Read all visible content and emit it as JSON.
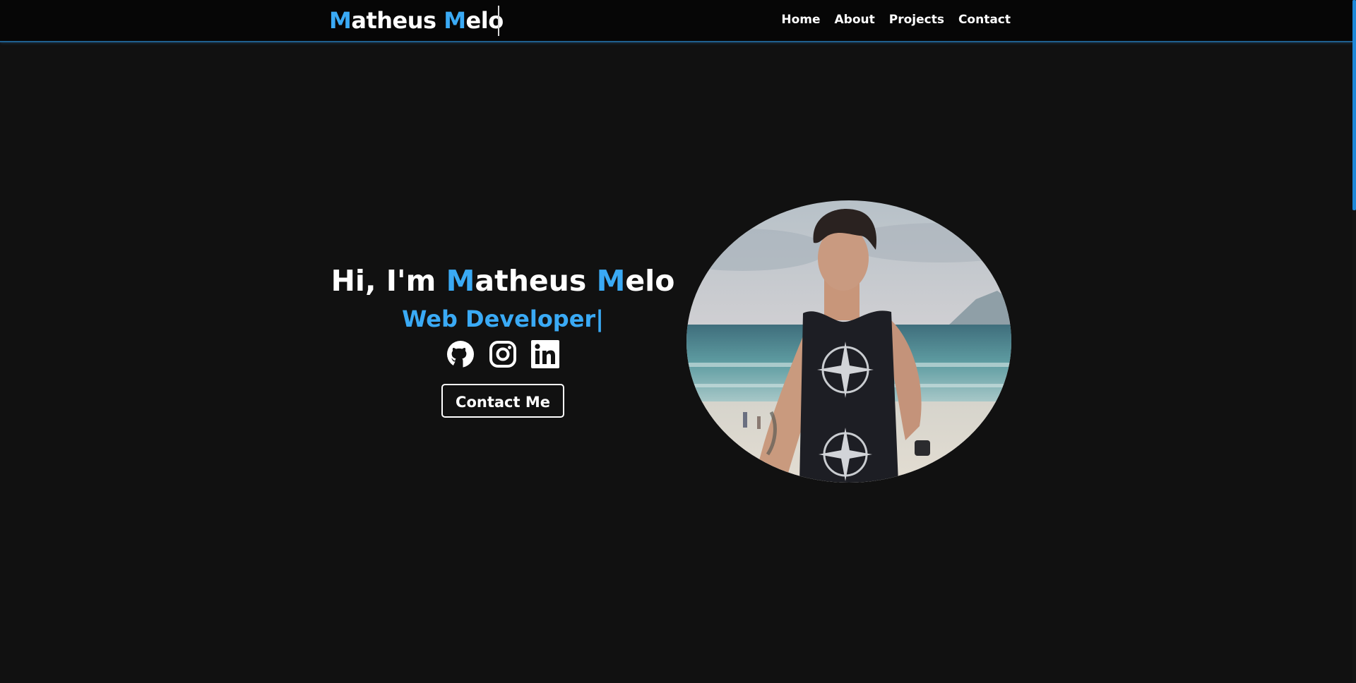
{
  "nav": {
    "logo": {
      "first_initial": "M",
      "first_rest": "atheus ",
      "last_initial": "M",
      "last_rest": "elo"
    },
    "links": [
      {
        "label": "Home"
      },
      {
        "label": "About"
      },
      {
        "label": "Projects"
      },
      {
        "label": "Contact"
      }
    ]
  },
  "hero": {
    "greeting": "Hi, I'm ",
    "name_first_initial": "M",
    "name_first_rest": "atheus ",
    "name_last_initial": "M",
    "name_last_rest": "elo",
    "role": "Web Developer|",
    "social": [
      {
        "icon": "github-icon"
      },
      {
        "icon": "instagram-icon"
      },
      {
        "icon": "linkedin-icon"
      }
    ],
    "contact_button": "Contact Me"
  },
  "colors": {
    "accent": "#3aaaf5",
    "background": "#111111",
    "navbar": "#060606",
    "scrollbar_thumb": "#1e88d8"
  }
}
